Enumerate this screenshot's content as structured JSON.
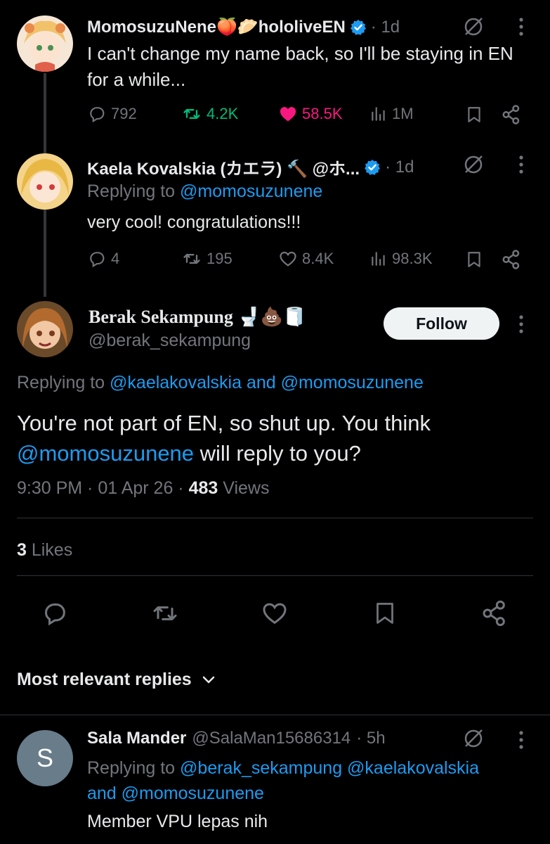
{
  "colors": {
    "background": "#000000",
    "text": "#e7e9ea",
    "muted": "#71767b",
    "link": "#1d9bf0",
    "like": "#f91880",
    "retweet": "#00ba7c"
  },
  "tweet1": {
    "display_name": "MomosuzuNene🍑🥟hololiveEN",
    "time": "· 1d",
    "text": "I can't change my name back, so I'll be staying in EN for a while...",
    "replies": "792",
    "retweets": "4.2K",
    "likes": "58.5K",
    "views": "1M"
  },
  "tweet2": {
    "display_name": "Kaela Kovalskia (カエラ) 🔨 @ホ...",
    "time": "· 1d",
    "replying_label": "Replying to",
    "replying_to": "@momosuzunene",
    "text": "very cool! congratulations!!!",
    "replies": "4",
    "retweets": "195",
    "likes": "8.4K",
    "views": "98.3K"
  },
  "main_tweet": {
    "display_name": "Berak Sekampung 🚽💩🧻",
    "handle": "@berak_sekampung",
    "follow_label": "Follow",
    "replying_label": "Replying to",
    "replying_to": "@kaelakovalskia and @momosuzunene",
    "text_part1": "You're not part of EN, so shut up. You think",
    "mention": "@momosuzunene",
    "text_part2": " will reply to you?",
    "timestamp": "9:30 PM · 01 Apr 26 · ",
    "views_count": "483",
    "views_label": " Views",
    "likes_count": "3",
    "likes_label": " Likes"
  },
  "sort": {
    "label": "Most relevant replies"
  },
  "reply1": {
    "display_name": "Sala Mander",
    "handle": "@SalaMan15686314",
    "time": "· 5h",
    "avatar_letter": "S",
    "replying_label": "Replying to",
    "replying_to_line1": "@berak_sekampung @kaelakovalskia",
    "replying_and": "and",
    "replying_to_line2": "@momosuzunene",
    "text": "Member VPU lepas nih"
  }
}
